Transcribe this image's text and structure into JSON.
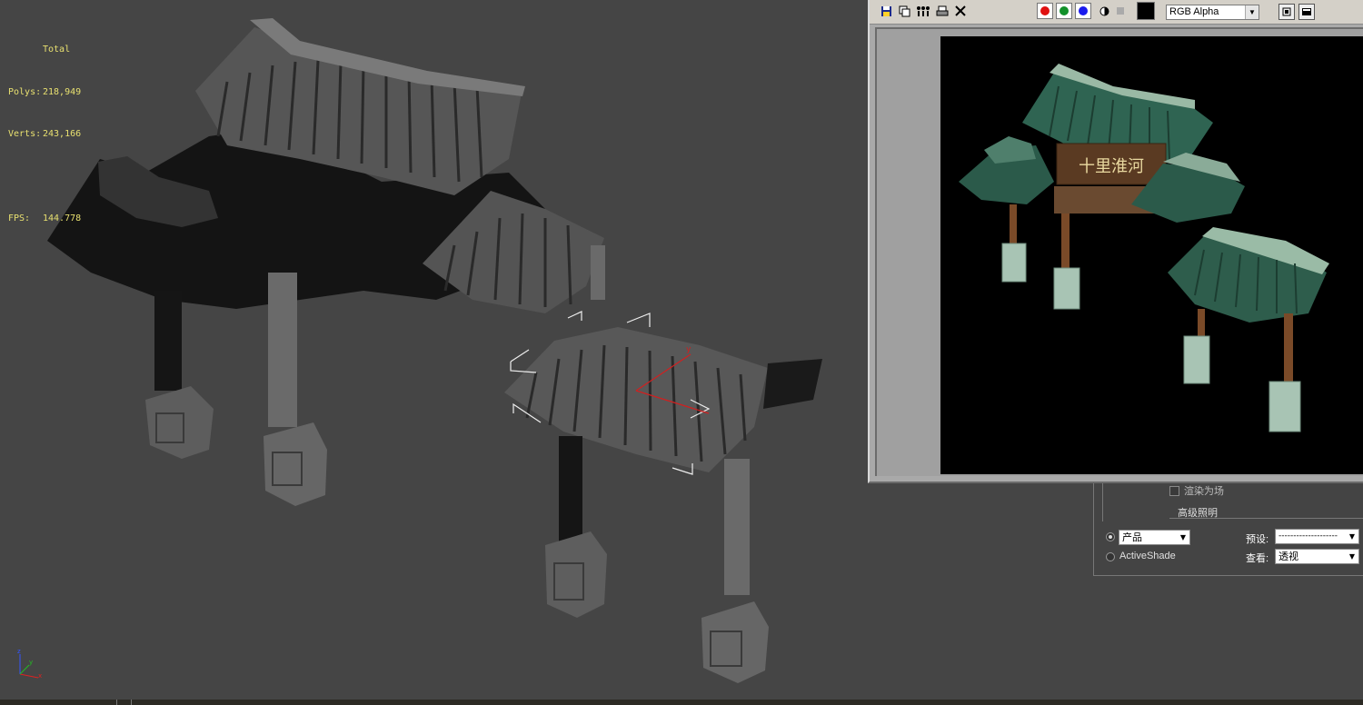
{
  "viewport": {
    "stats": {
      "header": "Total",
      "polys_label": "Polys:",
      "polys_value": "218,949",
      "verts_label": "Verts:",
      "verts_value": "243,166",
      "fps_label": "FPS:",
      "fps_value": "144.778"
    },
    "axis": {
      "x": "x",
      "y": "y",
      "z": "z"
    },
    "gizmo_label": "y",
    "colors": {
      "background": "#454545",
      "stats_text": "#e8e070"
    }
  },
  "frame_window": {
    "toolbar_icons": [
      "save-icon",
      "clone-icon",
      "print-icon",
      "clear-icon"
    ],
    "channel_buttons": [
      {
        "name": "red-channel",
        "color": "#e01010"
      },
      {
        "name": "green-channel",
        "color": "#12902a"
      },
      {
        "name": "blue-channel",
        "color": "#1a1aee"
      }
    ],
    "display_channel": "RGB Alpha",
    "render_sign": "十里淮河"
  },
  "render_setup": {
    "row1_label": "渲染为场",
    "row2_label": "高级照明",
    "mode_product": "产品",
    "mode_activeshade": "ActiveShade",
    "preset_label": "预设:",
    "preset_value": "--------------------",
    "view_label": "查看:",
    "view_value": "透视"
  }
}
